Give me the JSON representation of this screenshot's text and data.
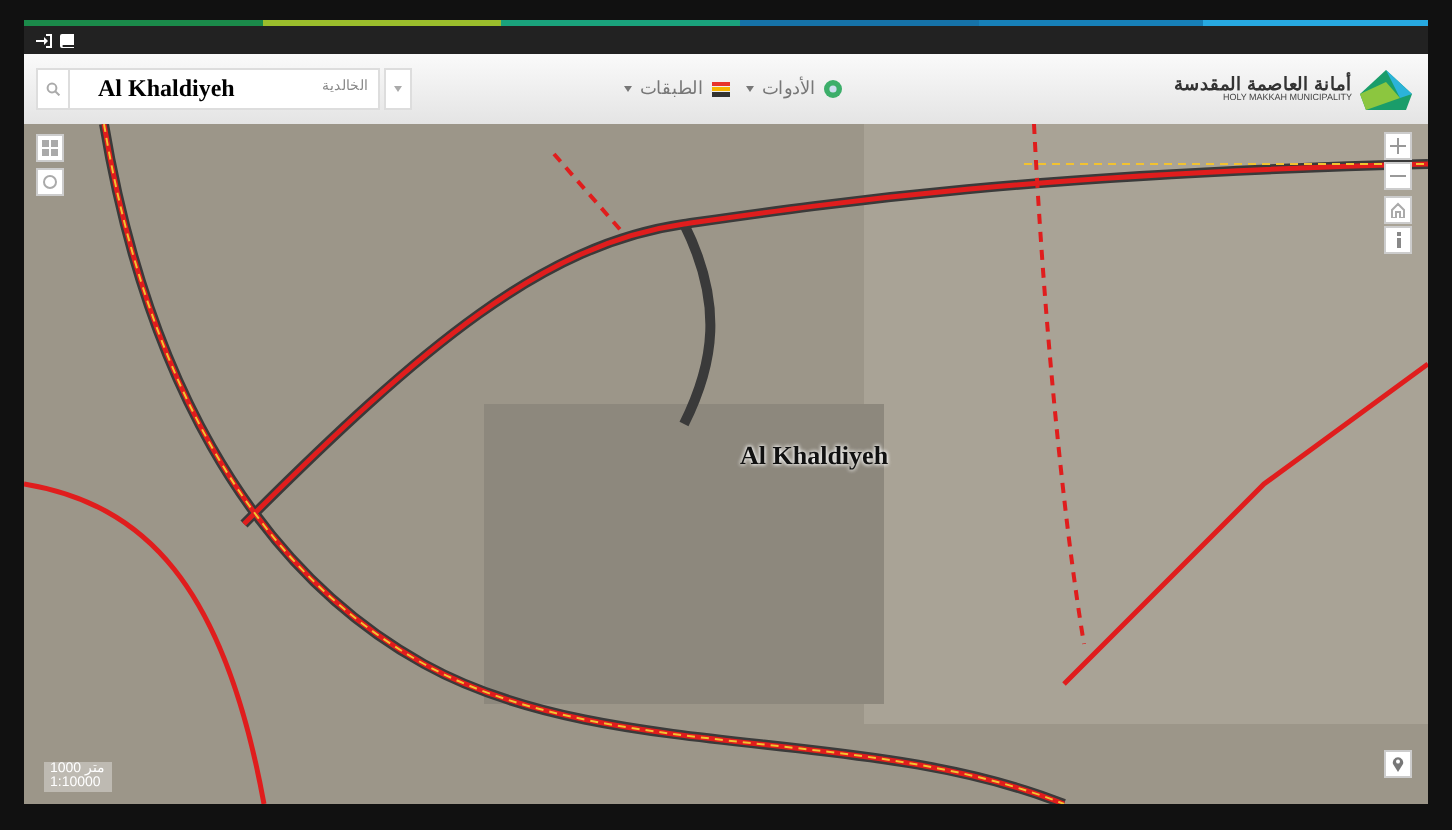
{
  "header": {
    "logo": {
      "title_ar": "أمانة العاصمة المقدسة",
      "title_en": "HOLY MAKKAH MUNICIPALITY"
    },
    "menus": [
      {
        "kind": "tools",
        "label": "الأدوات"
      },
      {
        "kind": "layers",
        "label": "الطبقات"
      }
    ],
    "search": {
      "value": "Al Khaldiyeh",
      "hint": "الخالدية"
    }
  },
  "map": {
    "label": "Al Khaldiyeh",
    "scale": {
      "distance": "1000 متر",
      "ratio": "1:10000"
    }
  }
}
